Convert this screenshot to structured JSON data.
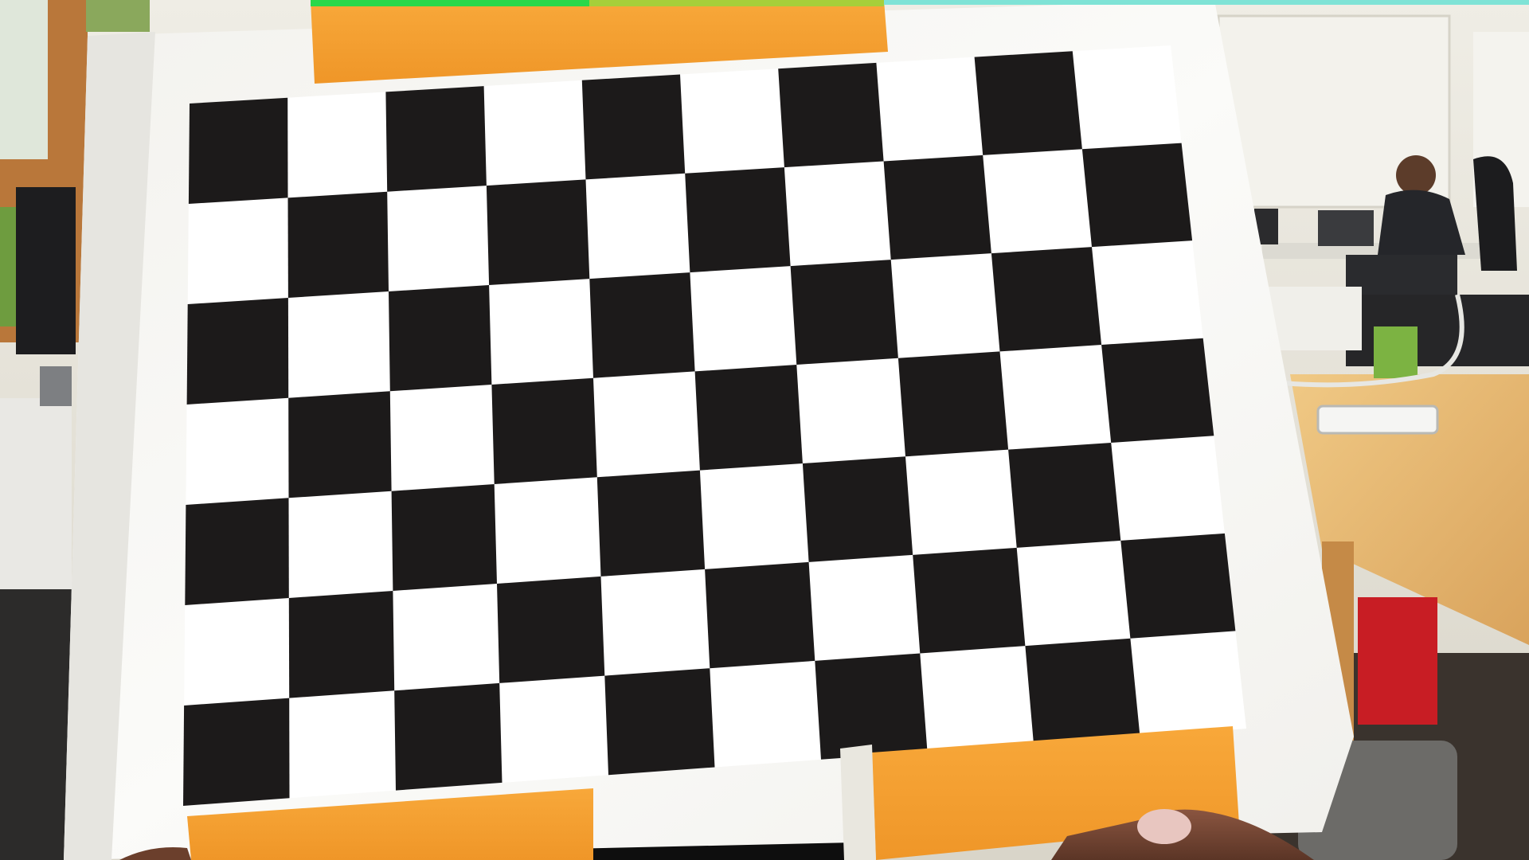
{
  "photo": {
    "subject": "checkerboard-calibration-target",
    "board": {
      "rows": 7,
      "cols": 10,
      "dark_color": "#1c1a1a",
      "light_color": "#ffffff"
    },
    "colors": {
      "paper": "#f7f6f3",
      "tape": "#f5a032",
      "wall": "#ece9e0",
      "wood_table": "#e6bb74",
      "window_frame": "#b9773a",
      "skin": "#7a4a34"
    }
  }
}
